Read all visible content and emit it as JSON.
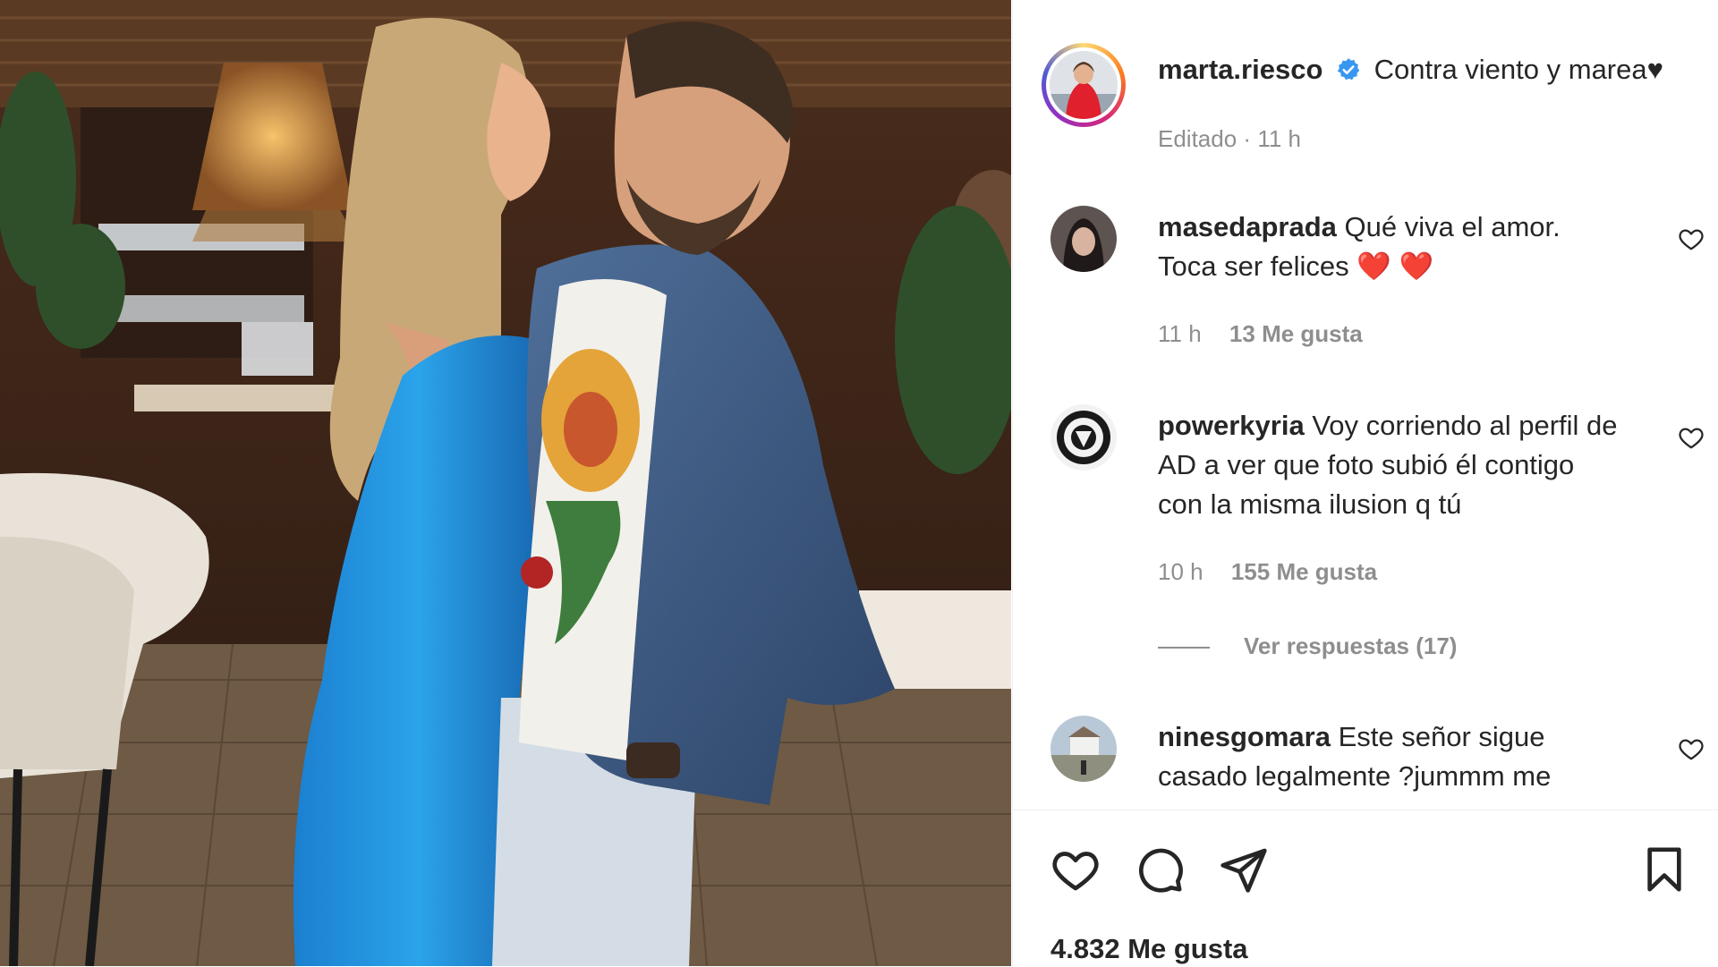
{
  "post": {
    "username": "marta.riesco",
    "caption": "Contra viento y marea♥",
    "edited_label": "Editado",
    "time": "11 h",
    "likes_label": "4.832 Me gusta"
  },
  "comments": [
    {
      "username": "masedaprada",
      "text": "Qué viva el amor. Toca ser felices",
      "emoji": "❤️ ❤️",
      "time": "11 h",
      "likes": "13 Me gusta"
    },
    {
      "username": "powerkyria",
      "text": "Voy corriendo al perfil de AD a ver que foto subió él contigo con la misma ilusion q tú",
      "time": "10 h",
      "likes": "155 Me gusta",
      "replies_label": "Ver respuestas (17)"
    },
    {
      "username": "ninesgomara",
      "text": "Este señor sigue casado legalmente ?jummm me"
    }
  ],
  "icons": {
    "verified": "verified-badge-icon",
    "like": "heart-icon",
    "comment": "comment-icon",
    "share": "share-icon",
    "save": "bookmark-icon"
  },
  "colors": {
    "verified_blue": "#3897f0",
    "secondary_text": "#8e8e8e",
    "heart_red": "#e0243a"
  }
}
